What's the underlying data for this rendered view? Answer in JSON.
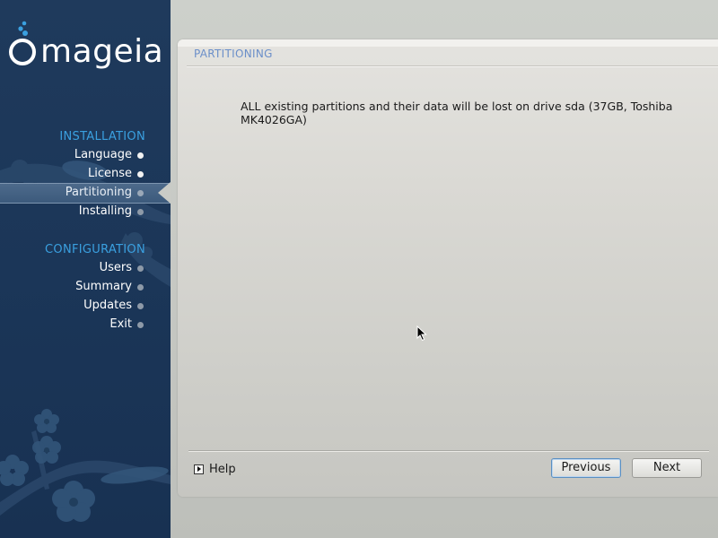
{
  "app": {
    "brand": "mageia"
  },
  "sidebar": {
    "sections": [
      {
        "title": "INSTALLATION",
        "steps": [
          {
            "label": "Language",
            "state": "done"
          },
          {
            "label": "License",
            "state": "done"
          },
          {
            "label": "Partitioning",
            "state": "active"
          },
          {
            "label": "Installing",
            "state": "pending"
          }
        ]
      },
      {
        "title": "CONFIGURATION",
        "steps": [
          {
            "label": "Users",
            "state": "pending"
          },
          {
            "label": "Summary",
            "state": "pending"
          },
          {
            "label": "Updates",
            "state": "pending"
          },
          {
            "label": "Exit",
            "state": "pending"
          }
        ]
      }
    ]
  },
  "panel": {
    "title": "PARTITIONING",
    "message": "ALL existing partitions and their data will be lost on drive sda (37GB, Toshiba MK4026GA)"
  },
  "footer": {
    "help_label": "Help",
    "previous_label": "Previous",
    "next_label": "Next"
  },
  "colors": {
    "sidebar_background": "#1f3a5c",
    "section_title": "#3aa0e0",
    "panel_title": "#6b8fc9",
    "active_step": "#4d6a8b"
  },
  "icons": {
    "logo": "mageia-logo-icon",
    "help": "help-expand-icon",
    "cursor": "mouse-pointer-icon"
  }
}
